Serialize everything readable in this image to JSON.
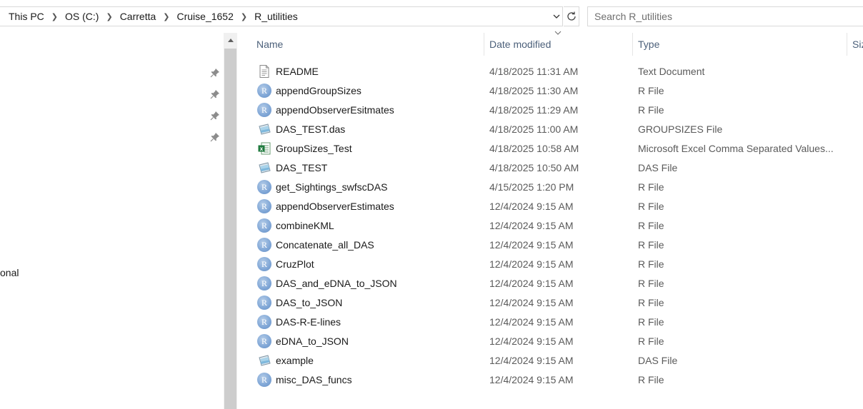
{
  "breadcrumb": [
    "This PC",
    "OS (C:)",
    "Carretta",
    "Cruise_1652",
    "R_utilities"
  ],
  "search": {
    "placeholder": "Search R_utilities"
  },
  "nav": {
    "partial_label": "onal"
  },
  "columns": {
    "name": "Name",
    "date": "Date modified",
    "type": "Type",
    "size": "Siz"
  },
  "files": [
    {
      "name": "README",
      "date": "4/18/2025 11:31 AM",
      "type": "Text Document",
      "icon": "text-doc"
    },
    {
      "name": "appendGroupSizes",
      "date": "4/18/2025 11:30 AM",
      "type": "R File",
      "icon": "r-file"
    },
    {
      "name": "appendObserverEsitmates",
      "date": "4/18/2025 11:29 AM",
      "type": "R File",
      "icon": "r-file"
    },
    {
      "name": "DAS_TEST.das",
      "date": "4/18/2025 11:00 AM",
      "type": "GROUPSIZES File",
      "icon": "das-file"
    },
    {
      "name": "GroupSizes_Test",
      "date": "4/18/2025 10:58 AM",
      "type": "Microsoft Excel Comma Separated Values...",
      "icon": "excel-csv"
    },
    {
      "name": "DAS_TEST",
      "date": "4/18/2025 10:50 AM",
      "type": "DAS File",
      "icon": "das-file"
    },
    {
      "name": "get_Sightings_swfscDAS",
      "date": "4/15/2025 1:20 PM",
      "type": "R File",
      "icon": "r-file"
    },
    {
      "name": "appendObserverEstimates",
      "date": "12/4/2024 9:15 AM",
      "type": "R File",
      "icon": "r-file"
    },
    {
      "name": "combineKML",
      "date": "12/4/2024 9:15 AM",
      "type": "R File",
      "icon": "r-file"
    },
    {
      "name": "Concatenate_all_DAS",
      "date": "12/4/2024 9:15 AM",
      "type": "R File",
      "icon": "r-file"
    },
    {
      "name": "CruzPlot",
      "date": "12/4/2024 9:15 AM",
      "type": "R File",
      "icon": "r-file"
    },
    {
      "name": "DAS_and_eDNA_to_JSON",
      "date": "12/4/2024 9:15 AM",
      "type": "R File",
      "icon": "r-file"
    },
    {
      "name": "DAS_to_JSON",
      "date": "12/4/2024 9:15 AM",
      "type": "R File",
      "icon": "r-file"
    },
    {
      "name": "DAS-R-E-lines",
      "date": "12/4/2024 9:15 AM",
      "type": "R File",
      "icon": "r-file"
    },
    {
      "name": "eDNA_to_JSON",
      "date": "12/4/2024 9:15 AM",
      "type": "R File",
      "icon": "r-file"
    },
    {
      "name": "example",
      "date": "12/4/2024 9:15 AM",
      "type": "DAS File",
      "icon": "das-file"
    },
    {
      "name": "misc_DAS_funcs",
      "date": "12/4/2024 9:15 AM",
      "type": "R File",
      "icon": "r-file"
    }
  ]
}
